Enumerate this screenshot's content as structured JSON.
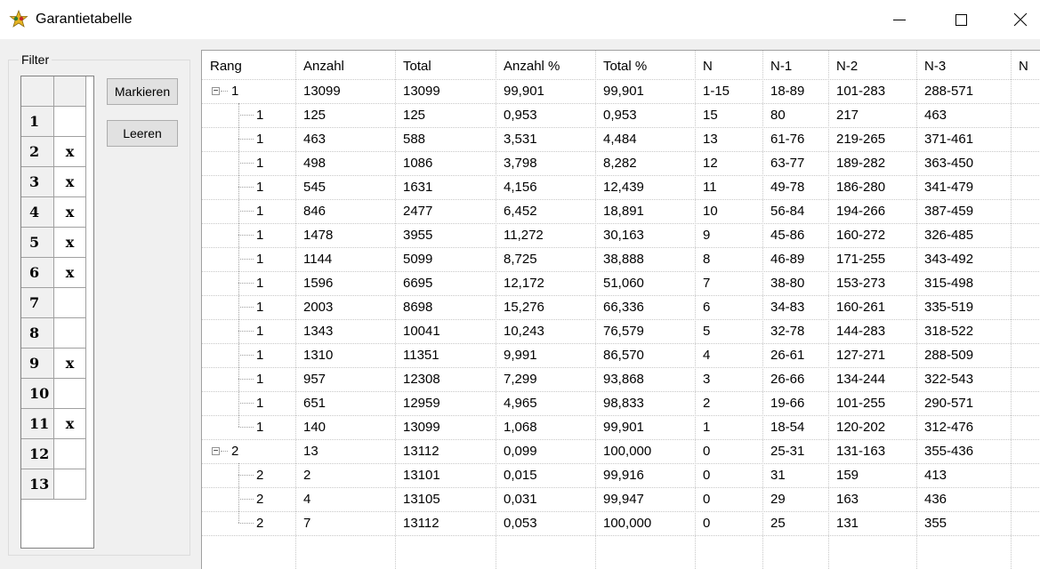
{
  "window": {
    "title": "Garantietabelle"
  },
  "filter": {
    "legend": "Filter",
    "rows": [
      {
        "num": "1",
        "mark": ""
      },
      {
        "num": "2",
        "mark": "x"
      },
      {
        "num": "3",
        "mark": "x"
      },
      {
        "num": "4",
        "mark": "x"
      },
      {
        "num": "5",
        "mark": "x"
      },
      {
        "num": "6",
        "mark": "x"
      },
      {
        "num": "7",
        "mark": ""
      },
      {
        "num": "8",
        "mark": ""
      },
      {
        "num": "9",
        "mark": "x"
      },
      {
        "num": "10",
        "mark": ""
      },
      {
        "num": "11",
        "mark": "x"
      },
      {
        "num": "12",
        "mark": ""
      },
      {
        "num": "13",
        "mark": ""
      }
    ],
    "buttons": {
      "mark": "Markieren",
      "clear": "Leeren"
    }
  },
  "table": {
    "columns": [
      "Rang",
      "Anzahl",
      "Total",
      "Anzahl %",
      "Total %",
      "N",
      "N-1",
      "N-2",
      "N-3",
      "N"
    ],
    "rows": [
      {
        "level": 0,
        "expanded": true,
        "cells": [
          "1",
          "13099",
          "13099",
          "99,901",
          "99,901",
          "1-15",
          "18-89",
          "101-283",
          "288-571"
        ]
      },
      {
        "level": 1,
        "cells": [
          "1",
          "125",
          "125",
          "0,953",
          "0,953",
          "15",
          "80",
          "217",
          "463"
        ]
      },
      {
        "level": 1,
        "cells": [
          "1",
          "463",
          "588",
          "3,531",
          "4,484",
          "13",
          "61-76",
          "219-265",
          "371-461"
        ]
      },
      {
        "level": 1,
        "cells": [
          "1",
          "498",
          "1086",
          "3,798",
          "8,282",
          "12",
          "63-77",
          "189-282",
          "363-450"
        ]
      },
      {
        "level": 1,
        "cells": [
          "1",
          "545",
          "1631",
          "4,156",
          "12,439",
          "11",
          "49-78",
          "186-280",
          "341-479"
        ]
      },
      {
        "level": 1,
        "cells": [
          "1",
          "846",
          "2477",
          "6,452",
          "18,891",
          "10",
          "56-84",
          "194-266",
          "387-459"
        ]
      },
      {
        "level": 1,
        "cells": [
          "1",
          "1478",
          "3955",
          "11,272",
          "30,163",
          "9",
          "45-86",
          "160-272",
          "326-485"
        ]
      },
      {
        "level": 1,
        "cells": [
          "1",
          "1144",
          "5099",
          "8,725",
          "38,888",
          "8",
          "46-89",
          "171-255",
          "343-492"
        ]
      },
      {
        "level": 1,
        "cells": [
          "1",
          "1596",
          "6695",
          "12,172",
          "51,060",
          "7",
          "38-80",
          "153-273",
          "315-498"
        ]
      },
      {
        "level": 1,
        "cells": [
          "1",
          "2003",
          "8698",
          "15,276",
          "66,336",
          "6",
          "34-83",
          "160-261",
          "335-519"
        ]
      },
      {
        "level": 1,
        "cells": [
          "1",
          "1343",
          "10041",
          "10,243",
          "76,579",
          "5",
          "32-78",
          "144-283",
          "318-522"
        ]
      },
      {
        "level": 1,
        "cells": [
          "1",
          "1310",
          "11351",
          "9,991",
          "86,570",
          "4",
          "26-61",
          "127-271",
          "288-509"
        ]
      },
      {
        "level": 1,
        "cells": [
          "1",
          "957",
          "12308",
          "7,299",
          "93,868",
          "3",
          "26-66",
          "134-244",
          "322-543"
        ]
      },
      {
        "level": 1,
        "cells": [
          "1",
          "651",
          "12959",
          "4,965",
          "98,833",
          "2",
          "19-66",
          "101-255",
          "290-571"
        ]
      },
      {
        "level": 1,
        "last": true,
        "cells": [
          "1",
          "140",
          "13099",
          "1,068",
          "99,901",
          "1",
          "18-54",
          "120-202",
          "312-476"
        ]
      },
      {
        "level": 0,
        "expanded": true,
        "cells": [
          "2",
          "13",
          "13112",
          "0,099",
          "100,000",
          "0",
          "25-31",
          "131-163",
          "355-436"
        ]
      },
      {
        "level": 1,
        "cells": [
          "2",
          "2",
          "13101",
          "0,015",
          "99,916",
          "0",
          "31",
          "159",
          "413"
        ]
      },
      {
        "level": 1,
        "cells": [
          "2",
          "4",
          "13105",
          "0,031",
          "99,947",
          "0",
          "29",
          "163",
          "436"
        ]
      },
      {
        "level": 1,
        "last": true,
        "cells": [
          "2",
          "7",
          "13112",
          "0,053",
          "100,000",
          "0",
          "25",
          "131",
          "355"
        ]
      }
    ]
  }
}
